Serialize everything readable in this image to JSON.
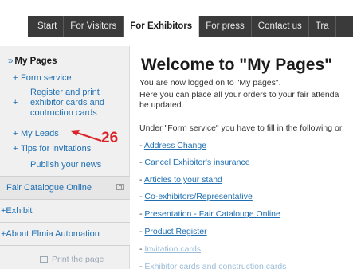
{
  "nav": {
    "tabs": [
      {
        "label": "Start",
        "active": false
      },
      {
        "label": "For Visitors",
        "active": false
      },
      {
        "label": "For Exhibitors",
        "active": true
      },
      {
        "label": "For press",
        "active": false
      },
      {
        "label": "Contact us",
        "active": false
      },
      {
        "label": "Tra",
        "active": false
      }
    ]
  },
  "sidebar": {
    "heading": "My Pages",
    "items": [
      {
        "label": "Form service"
      },
      {
        "label": "Register and print exhibitor cards and contruction cards"
      },
      {
        "label": "My Leads"
      },
      {
        "label": "Tips for invitations"
      },
      {
        "label": "Publish your news"
      }
    ],
    "rows": [
      {
        "label": "Fair Catalogue Online"
      },
      {
        "label": "+Exhibit"
      },
      {
        "label": "+About Elmia Automation"
      }
    ],
    "print_label": "Print the page"
  },
  "main": {
    "title": "Welcome to \"My Pages\"",
    "para1": "You are now logged on to \"My pages\".",
    "para2": "Here you can place all your orders to your fair attenda",
    "para3": "be updated.",
    "para4": "Under \"Form service\" you have to fill in the following or",
    "links": [
      "Address Change",
      "Cancel Exhibitor's insurance",
      "Articles to your stand",
      "Co-exhibitors/Representative",
      "Presentation - Fair Catalouge Online",
      "Product Register",
      "Invitation cards",
      "Exhibitor cards and construction cards"
    ]
  },
  "callout": {
    "number": "26",
    "color": "#d9252a"
  }
}
